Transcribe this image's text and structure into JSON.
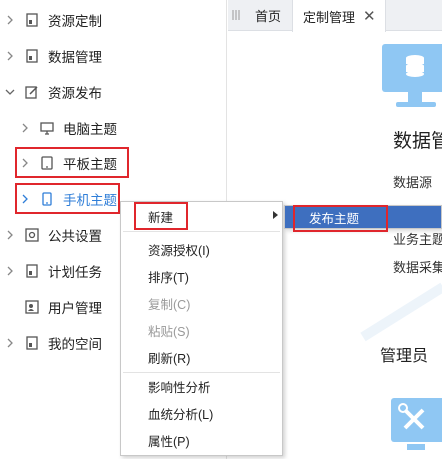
{
  "sidebar": {
    "items": [
      {
        "label": "资源定制",
        "icon": "document-icon",
        "expanded": false
      },
      {
        "label": "数据管理",
        "icon": "document-icon",
        "expanded": false
      },
      {
        "label": "资源发布",
        "icon": "edit-icon",
        "expanded": true
      },
      {
        "label": "电脑主题",
        "icon": "monitor-icon",
        "expanded": false
      },
      {
        "label": "平板主题",
        "icon": "tablet-icon",
        "expanded": false
      },
      {
        "label": "手机主题",
        "icon": "phone-icon",
        "expanded": false,
        "selected": true
      },
      {
        "label": "公共设置",
        "icon": "gear-icon",
        "expanded": false
      },
      {
        "label": "计划任务",
        "icon": "document-icon",
        "expanded": false
      },
      {
        "label": "用户管理",
        "icon": "user-icon",
        "expanded": false
      },
      {
        "label": "我的空间",
        "icon": "document-icon",
        "expanded": false
      }
    ]
  },
  "tabs": {
    "home_label": "首页",
    "active_label": "定制管理",
    "close_glyph": "✕",
    "handle_glyph": "III"
  },
  "main": {
    "heading1": "数据管",
    "line1": "数据源",
    "line2": "业务主题",
    "line3": "数据采集",
    "heading2": "管理员"
  },
  "context_menu": {
    "items": [
      {
        "label": "新建",
        "disabled": false,
        "has_submenu": true
      },
      {
        "label": "资源授权(I)",
        "disabled": false
      },
      {
        "label": "排序(T)",
        "disabled": false
      },
      {
        "label": "复制(C)",
        "disabled": true
      },
      {
        "label": "粘贴(S)",
        "disabled": true
      },
      {
        "label": "刷新(R)",
        "disabled": false
      },
      {
        "label": "影响性分析",
        "disabled": false
      },
      {
        "label": "血统分析(L)",
        "disabled": false
      },
      {
        "label": "属性(P)",
        "disabled": false
      }
    ]
  },
  "submenu": {
    "items": [
      {
        "label": "发布主题",
        "highlighted": true
      }
    ]
  },
  "colors": {
    "selected_text": "#2f7ed8",
    "highlight_bar": "#3e6fbf",
    "annotation_box": "#e0262c",
    "illustration_blue": "#8fc7f3"
  }
}
